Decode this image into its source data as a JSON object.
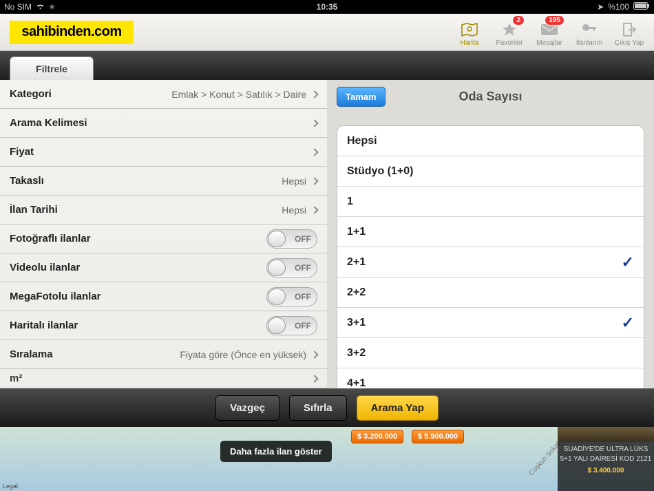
{
  "statusbar": {
    "carrier": "No SIM",
    "time": "10:35",
    "battery": "%100"
  },
  "logo": "sahibinden.com",
  "topbuttons": {
    "harita": "Harita",
    "favoriler": {
      "label": "Favoriler",
      "badge": "2"
    },
    "mesajlar": {
      "label": "Mesajlar",
      "badge": "195"
    },
    "ilanlarim": "İlanlarım",
    "cikis": "Çıkış Yap"
  },
  "filter_tab": "Filtrele",
  "filters": {
    "kategori": {
      "label": "Kategori",
      "value": "Emlak > Konut > Satılık > Daire"
    },
    "arama": {
      "label": "Arama Kelimesi"
    },
    "fiyat": {
      "label": "Fiyat"
    },
    "takasli": {
      "label": "Takaslı",
      "value": "Hepsi"
    },
    "tarih": {
      "label": "İlan Tarihi",
      "value": "Hepsi"
    },
    "fotografli": {
      "label": "Fotoğraflı ilanlar",
      "off": "OFF"
    },
    "videolu": {
      "label": "Videolu ilanlar",
      "off": "OFF"
    },
    "megafoto": {
      "label": "MegaFotolu ilanlar",
      "off": "OFF"
    },
    "haritali": {
      "label": "Haritalı ilanlar",
      "off": "OFF"
    },
    "siralama": {
      "label": "Sıralama",
      "value": "Fiyata göre (Önce en yüksek)"
    },
    "m2": {
      "label": "m²"
    }
  },
  "detail": {
    "done": "Tamam",
    "title": "Oda Sayısı",
    "options": [
      "Hepsi",
      "Stüdyo (1+0)",
      "1",
      "1+1",
      "2+1",
      "2+2",
      "3+1",
      "3+2",
      "4+1"
    ],
    "selected": {
      "4": true,
      "6": true
    }
  },
  "actions": {
    "vazgec": "Vazgeç",
    "sifirla": "Sıfırla",
    "arama": "Arama Yap"
  },
  "map": {
    "more": "Daha fazla ilan göster",
    "legal": "Legal",
    "pin1": "$ 3.200.000",
    "pin2": "$ 5.900.000",
    "road": "Coşkun Sokak",
    "listing": {
      "title": "SUADİYE'DE ULTRA LÜKS 5+1 YALI DAİRESİ KOD 2121",
      "price": "$ 3.400.000"
    }
  }
}
